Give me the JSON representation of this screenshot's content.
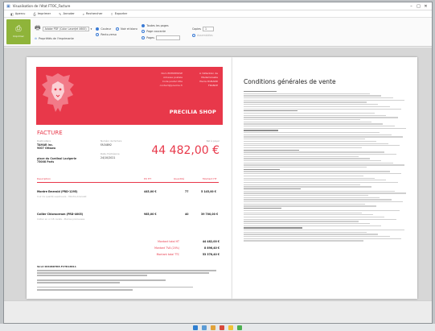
{
  "window": {
    "title": "Visualisation de l'état FTOC_Facture"
  },
  "menu": {
    "items": [
      {
        "label": "Apercu",
        "icon": "preview-icon"
      },
      {
        "label": "Imprimer",
        "icon": "printer-icon"
      },
      {
        "label": "Annoter",
        "icon": "pen-icon"
      },
      {
        "label": "Rechercher",
        "icon": "search-icon"
      },
      {
        "label": "Exporter",
        "icon": "export-icon"
      }
    ]
  },
  "ribbon": {
    "print_label": "Imprimer",
    "printer_name": "Adobe PDF (Color LaserJet 4600)",
    "preferences_label": "Propriétés de l'imprimante",
    "color_label": "Couleur",
    "bw_label": "Noir et blanc",
    "rect_verso_label": "Recto-verso",
    "all_pages_label": "Toutes les pages",
    "current_page_label": "Page courante",
    "pages_label": "Pages",
    "copies_label": "Copies",
    "copies_value": "1",
    "assembled_label": "Assemblées"
  },
  "invoice": {
    "seller_lines": [
      "Nom ENTREPRISE",
      "Adresse postale",
      "Code postal Ville",
      "contact@precilia.fr"
    ],
    "client_lines": [
      "A l'attention de",
      "Mademoiselle",
      "Pierre DURAND",
      "FRANCE"
    ],
    "shop_name": "PRECILIA SHOP",
    "doc_title": "FACTURE",
    "client_label": "Destinataire",
    "client_name": "TAMAR inc.",
    "client_addr": "9007 Ottawa",
    "client_addr2": "place du Cardinal Lavigerie",
    "client_city": "75008 Paris",
    "ref_label": "Numéro de facture",
    "ref_value": "FA34892",
    "date_label": "Date d'échéance",
    "date_value": "24/10/2021",
    "total_label": "Net à payer",
    "total_value": "44 482,00 €",
    "col_description": "Description",
    "col_unit": "PU HT",
    "col_qty": "Quantité",
    "col_amount": "Montant HT",
    "items": [
      {
        "name": "Montre Emerald (PRD-1295)",
        "detail": "Cuir de qualité supérieure - Montre-bracelet",
        "unit": "445,00 €",
        "qty": "77",
        "amount": "5 145,00 €"
      },
      {
        "name": "Collier Chloroceram (PRD-4005)",
        "detail": "Collier en or 18 carats - Pierres précieuses",
        "unit": "985,00 €",
        "qty": "40",
        "amount": "39 700,00 €"
      }
    ],
    "totals": [
      {
        "label": "Montant total HT",
        "value": "44 482,00 €"
      },
      {
        "label": "Montant TVA (20%)",
        "value": "8 896,40 €"
      },
      {
        "label": "Montant total TTC",
        "value": "53 378,40 €"
      }
    ],
    "legal_heading": "Siret 48408DTRE-FCTR18811"
  },
  "cgv": {
    "title": "Conditions générales de vente"
  }
}
